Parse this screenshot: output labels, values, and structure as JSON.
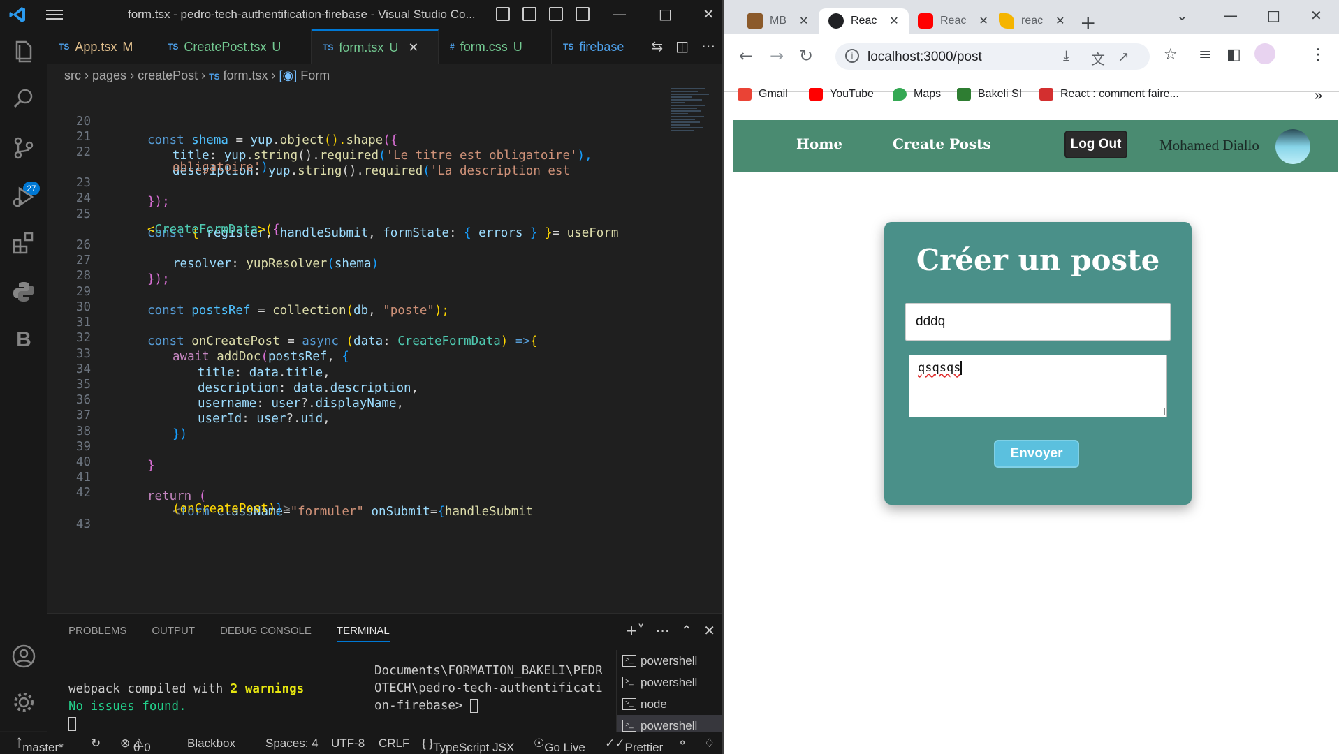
{
  "vscode": {
    "window_title": "form.tsx - pedro-tech-authentification-firebase - Visual Studio Co...",
    "activity_badge": "27",
    "tabs": [
      {
        "label": "App.tsx",
        "status": "M"
      },
      {
        "label": "CreatePost.tsx",
        "status": "U"
      },
      {
        "label": "form.tsx",
        "status": "U"
      },
      {
        "label": "form.css",
        "status": "U"
      },
      {
        "label": "firebase",
        "status": ""
      }
    ],
    "tab_prefix_ts": "TS",
    "tab_prefix_css": "#",
    "breadcrumb": {
      "p1": "src",
      "p2": "pages",
      "p3": "createPost",
      "p4": "form.tsx",
      "p5": "Form"
    },
    "line_numbers": [
      "20",
      "21",
      "22",
      "23",
      "24",
      "25",
      "26",
      "27",
      "28",
      "29",
      "30",
      "31",
      "32",
      "33",
      "34",
      "35",
      "36",
      "37",
      "38",
      "39",
      "40",
      "41",
      "42",
      "43"
    ],
    "code": {
      "l20": {
        "a": "const ",
        "b": "shema",
        "c": " = ",
        "d": "yup",
        "e": ".",
        "f": "object",
        "g": "().",
        "h": "shape",
        "i": "({"
      },
      "l21": {
        "a": "title",
        "b": ": ",
        "c": "yup",
        "d": ".",
        "e": "string",
        "f": "().",
        "g": "required",
        "h": "(",
        "i": "'Le titre est obligatoire'",
        "j": "),"
      },
      "l22a": {
        "a": "description",
        "b": ": ",
        "c": "yup",
        "d": ".",
        "e": "string",
        "f": "().",
        "g": "required",
        "h": "(",
        "i": "'La description est"
      },
      "l22b": {
        "a": "obligatoire'",
        "b": ")"
      },
      "l23": {
        "a": "});"
      },
      "l25a": {
        "a": "const ",
        "b": "{ ",
        "c": "register",
        "d": ", ",
        "e": "handleSubmit",
        "f": ", ",
        "g": "formState",
        "h": ": ",
        "i": "{ ",
        "j": "errors",
        "k": " } ",
        "l": "}",
        "m": "= ",
        "n": "useForm"
      },
      "l25b": {
        "a": "<",
        "b": "CreateFormData",
        "c": ">(",
        "d": "{"
      },
      "l26": {
        "a": "resolver",
        "b": ": ",
        "c": "yupResolver",
        "d": "(",
        "e": "shema",
        "f": ")"
      },
      "l27": {
        "a": "});"
      },
      "l29": {
        "a": "const ",
        "b": "postsRef",
        "c": " = ",
        "d": "collection",
        "e": "(",
        "f": "db",
        "g": ", ",
        "h": "\"poste\"",
        "i": ");"
      },
      "l31": {
        "a": "const ",
        "b": "onCreatePost",
        "c": " = ",
        "d": "async ",
        "e": "(",
        "f": "data",
        "g": ": ",
        "h": "CreateFormData",
        "i": ") ",
        "j": "=>",
        "k": "{"
      },
      "l32": {
        "a": "await ",
        "b": "addDoc",
        "c": "(",
        "d": "postsRef",
        "e": ", ",
        "f": "{"
      },
      "l33": {
        "a": "title",
        "b": ": ",
        "c": "data",
        "d": ".",
        "e": "title",
        "f": ","
      },
      "l34": {
        "a": "description",
        "b": ": ",
        "c": "data",
        "d": ".",
        "e": "description",
        "f": ","
      },
      "l35": {
        "a": "username",
        "b": ": ",
        "c": "user",
        "d": "?.",
        "e": "displayName",
        "f": ","
      },
      "l36": {
        "a": "userId",
        "b": ": ",
        "c": "user",
        "d": "?.",
        "e": "uid",
        "f": ","
      },
      "l37": {
        "a": "})"
      },
      "l39": {
        "a": "}"
      },
      "l41": {
        "a": "return ",
        "b": "("
      },
      "l42a": {
        "a": "<",
        "b": "form ",
        "c": "className",
        "d": "=",
        "e": "\"formuler\" ",
        "f": "onSubmit",
        "g": "=",
        "h": "{",
        "i": "handleSubmit"
      },
      "l42b": {
        "a": "(onCreatePost)",
        "b": "}",
        "c": ">"
      }
    },
    "panel": {
      "tabs": [
        "PROBLEMS",
        "OUTPUT",
        "DEBUG CONSOLE",
        "TERMINAL"
      ],
      "term_line1_a": "webpack compiled with ",
      "term_line1_b": "2 warnings",
      "term_line2": "No issues found.",
      "term_mid_1": "Documents\\FORMATION_BAKELI\\PEDR",
      "term_mid_2": "OTECH\\pedro-tech-authentificati",
      "term_mid_3": "on-firebase> ",
      "terminals": [
        "powershell",
        "powershell",
        "node",
        "powershell"
      ]
    },
    "status": {
      "branch": "master*",
      "errors": "0",
      "warnings": "0",
      "blackbox": "Blackbox",
      "spaces": "Spaces: 4",
      "encoding": "UTF-8",
      "eol": "CRLF",
      "language": "TypeScript JSX",
      "golive": "Go Live",
      "prettier": "Prettier"
    }
  },
  "chrome": {
    "tabs": [
      {
        "label": "MB",
        "color": "#8b5a2b"
      },
      {
        "label": "Reac",
        "color": "#202124"
      },
      {
        "label": "Reac",
        "color": "#ff0000"
      },
      {
        "label": "reac",
        "color": "#f5b400"
      }
    ],
    "url": "localhost:3000/post",
    "bookmarks": [
      {
        "label": "Gmail",
        "color": "#ea4335"
      },
      {
        "label": "YouTube",
        "color": "#ff0000"
      },
      {
        "label": "Maps",
        "color": "#34a853"
      },
      {
        "label": "Bakeli SI",
        "color": "#2e7d32"
      },
      {
        "label": "React : comment faire...",
        "color": "#d32f2f"
      }
    ],
    "more_bookmarks": "»"
  },
  "app": {
    "nav": {
      "home": "Home",
      "create_posts": "Create Posts",
      "logout": "Log Out",
      "username": "Mohamed Diallo"
    },
    "form": {
      "title": "Créer un poste",
      "title_value": "dddq",
      "description_value": "qsqsqs",
      "submit": "Envoyer"
    },
    "colors": {
      "navbar": "#4a8b71",
      "card": "#4a9089",
      "submit": "#5bc0de"
    }
  }
}
